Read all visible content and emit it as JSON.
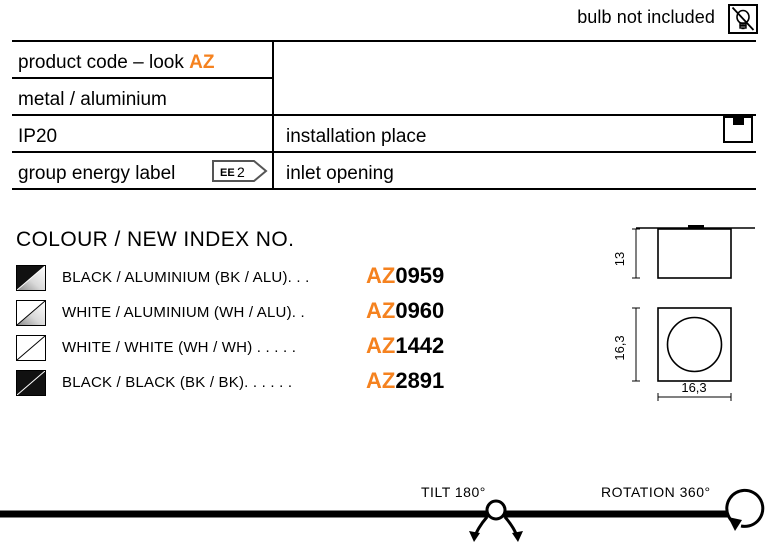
{
  "header": {
    "bulb_note": "bulb not included",
    "bulb_icon": "bulb-crossed-out-icon"
  },
  "spec_table": {
    "rows": [
      {
        "left_label": "product code – look ",
        "left_code": "AZ",
        "right_label": "",
        "right_icon": ""
      },
      {
        "left_label": "metal / aluminium",
        "left_code": "",
        "right_label": "",
        "right_icon": ""
      },
      {
        "left_label": "IP20",
        "left_code": "",
        "right_label": "installation place",
        "right_icon": "ceiling-mount-icon"
      },
      {
        "left_label": "group energy label",
        "left_code": "",
        "right_label": "inlet opening",
        "right_icon": ""
      }
    ],
    "energy_badge": "EE 2"
  },
  "colour_section": {
    "heading": "COLOUR / NEW INDEX NO.",
    "items": [
      {
        "swatch": "black-aluminium-swatch",
        "name": "BLACK / ALUMINIUM (BK / ALU)",
        "leader": ". . .",
        "code_prefix": "AZ",
        "code_number": "0959"
      },
      {
        "swatch": "white-aluminium-swatch",
        "name": "WHITE / ALUMINIUM (WH / ALU)",
        "leader": ". .",
        "code_prefix": "AZ",
        "code_number": "0960"
      },
      {
        "swatch": "white-white-swatch",
        "name": "WHITE / WHITE (WH / WH)",
        "leader": ". . . . .",
        "code_prefix": "AZ",
        "code_number": "1442"
      },
      {
        "swatch": "black-black-swatch",
        "name": "BLACK / BLACK (BK / BK)",
        "leader": ". . . . . .",
        "code_prefix": "AZ",
        "code_number": "2891"
      }
    ]
  },
  "drawing": {
    "side_view_height": "13",
    "bottom_view_height": "16,3",
    "bottom_view_width": "16,3"
  },
  "motion": {
    "tilt_label": "TILT 180°",
    "rotation_label": "ROTATION 360°",
    "tilt_icon": "tilt-arrows-icon",
    "rotation_icon": "rotation-arrow-icon"
  },
  "colors": {
    "accent_orange": "#F5821F",
    "line_black": "#000000",
    "background": "#FFFFFF"
  }
}
